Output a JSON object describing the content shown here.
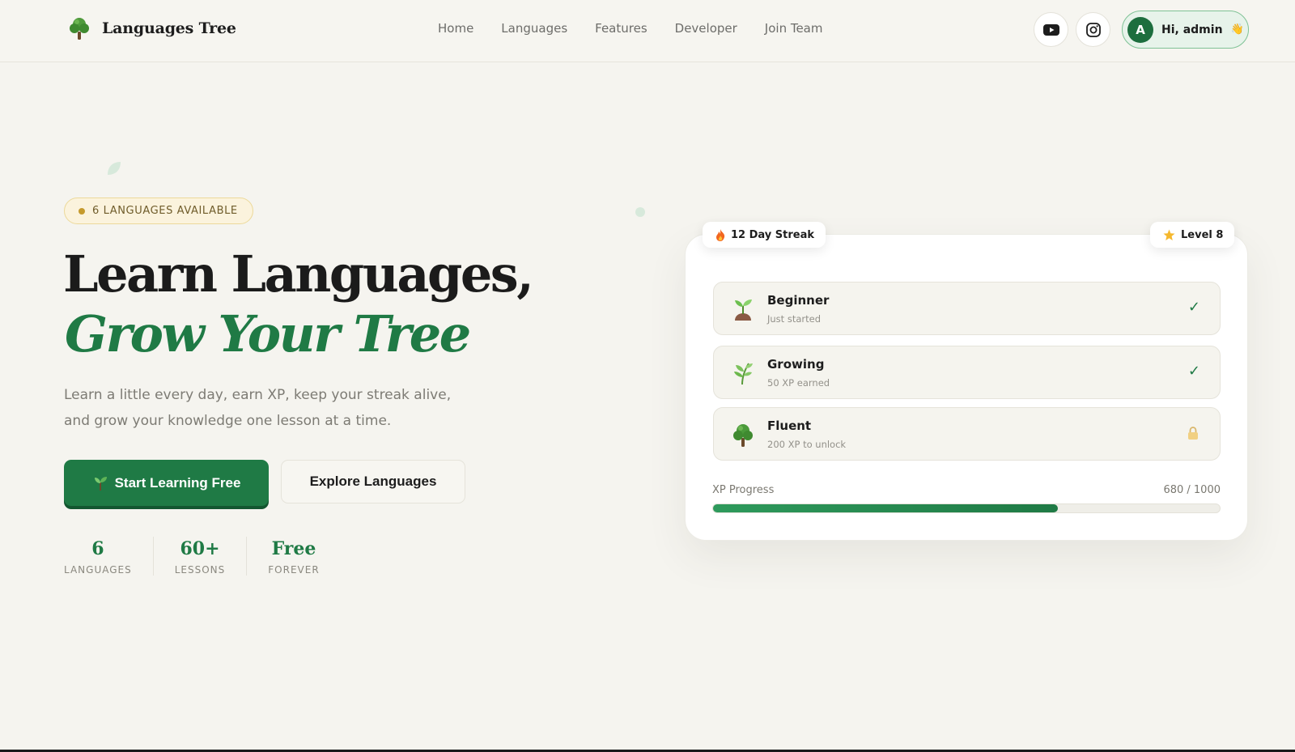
{
  "nav": {
    "brand": "Languages Tree",
    "links": [
      "Home",
      "Languages",
      "Features",
      "Developer",
      "Join Team"
    ],
    "social": [
      "youtube-icon",
      "instagram-icon"
    ],
    "user": {
      "avatar_letter": "A",
      "greeting": "Hi, admin",
      "emoji": "👋"
    }
  },
  "hero": {
    "badge": "6 LANGUAGES AVAILABLE",
    "title_line1": "Learn Languages,",
    "title_line2": "Grow Your Tree",
    "lead": "Learn a little every day, earn XP, keep your streak alive, and grow your knowledge one lesson at a time.",
    "cta_primary": "Start Learning Free",
    "cta_secondary": "Explore Languages",
    "stats": [
      {
        "value": "6",
        "label": "LANGUAGES"
      },
      {
        "value": "60+",
        "label": "LESSONS"
      },
      {
        "value": "Free",
        "label": "FOREVER"
      }
    ]
  },
  "card": {
    "streak": "12 Day Streak",
    "level": "Level 8",
    "stages": [
      {
        "name": "Beginner",
        "sub": "Just started",
        "status": "completed",
        "icon": "seedling-icon"
      },
      {
        "name": "Growing",
        "sub": "50 XP earned",
        "status": "completed",
        "icon": "herb-icon"
      },
      {
        "name": "Fluent",
        "sub": "200 XP to unlock",
        "status": "locked",
        "icon": "tree-icon"
      }
    ],
    "xp_label": "XP Progress",
    "xp_text": "680 / 1000",
    "xp_current": 680,
    "xp_max": 1000
  },
  "colors": {
    "brand_green": "#1f7a45",
    "background": "#f5f4ef",
    "badge_bg": "#fbf3dd"
  }
}
